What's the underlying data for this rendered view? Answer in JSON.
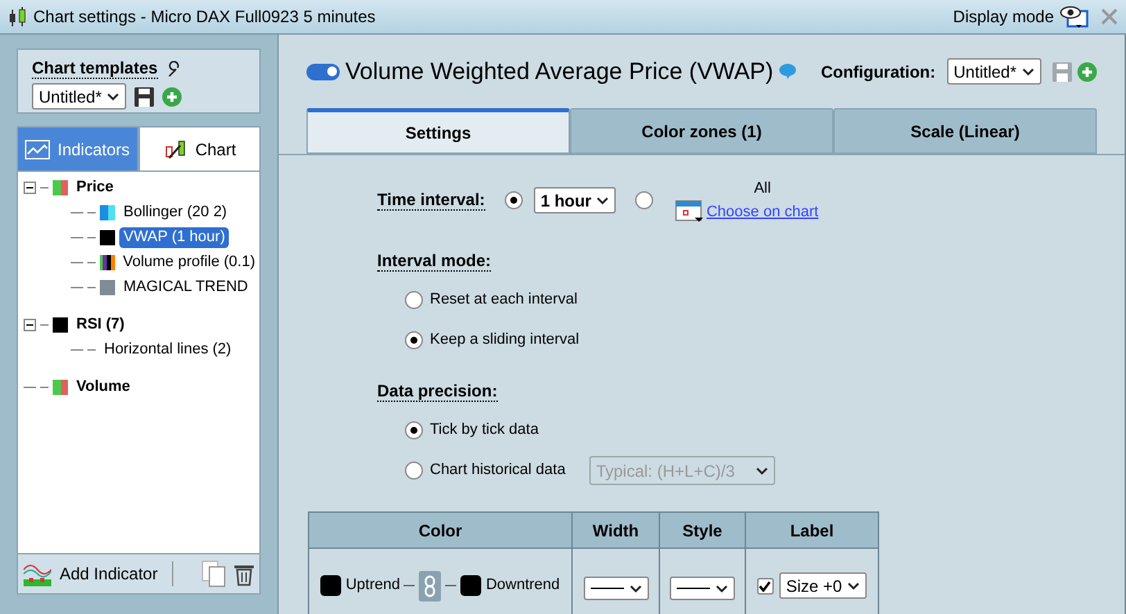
{
  "window": {
    "title": "Chart settings - Micro DAX Full0923 5 minutes",
    "display_mode": "Display mode"
  },
  "templates": {
    "label": "Chart templates",
    "value": "Untitled*"
  },
  "left_tabs": [
    {
      "label": "Indicators",
      "selected": true,
      "kind": "indicators"
    },
    {
      "label": "Chart",
      "selected": false,
      "kind": "chart"
    }
  ],
  "tree": [
    {
      "label": "Price",
      "bold": true,
      "expanded": true,
      "selected": false,
      "kind": "updown",
      "children": [
        {
          "label": "Bollinger (20 2)",
          "selected": false,
          "kind": "bands"
        },
        {
          "label": "VWAP (1 hour)",
          "selected": true,
          "kind": "solid",
          "color": "#000000"
        },
        {
          "label": "Volume profile (0.1)",
          "selected": false,
          "kind": "profile"
        },
        {
          "label": "MAGICAL TREND",
          "selected": false,
          "kind": "solid",
          "color": "#7f8c95"
        }
      ]
    },
    {
      "label": "RSI (7)",
      "bold": true,
      "expanded": true,
      "selected": false,
      "kind": "solid",
      "color": "#000000",
      "children": [
        {
          "label": "Horizontal lines (2)",
          "selected": false,
          "kind": "plain"
        }
      ]
    },
    {
      "label": "Volume",
      "bold": true,
      "selected": false,
      "kind": "updown"
    }
  ],
  "add_indicator": "Add Indicator",
  "indicator": {
    "enabled": true,
    "title": "Volume Weighted Average Price (VWAP)",
    "configuration_label": "Configuration:",
    "configuration_value": "Untitled*"
  },
  "tabs": [
    {
      "label": "Settings",
      "selected": true
    },
    {
      "label": "Color zones (1)",
      "selected": false
    },
    {
      "label": "Scale (Linear)",
      "selected": false
    }
  ],
  "time_interval": {
    "label": "Time interval:",
    "options": [
      {
        "kind": "select",
        "selected": true,
        "value": "1 hour"
      },
      {
        "kind": "chart",
        "selected": false,
        "caption": "All",
        "link": "Choose on chart"
      }
    ]
  },
  "interval_mode": {
    "label": "Interval mode:",
    "options": [
      {
        "label": "Reset at each interval",
        "selected": false
      },
      {
        "label": "Keep a sliding interval",
        "selected": true
      }
    ]
  },
  "data_precision": {
    "label": "Data precision:",
    "options": [
      {
        "label": "Tick by tick data",
        "selected": true
      },
      {
        "label": "Chart historical data",
        "selected": false,
        "select": "Typical: (H+L+C)/3"
      }
    ]
  },
  "table": {
    "columns": [
      "Color",
      "Width",
      "Style",
      "Label"
    ],
    "row": {
      "uptrend": {
        "label": "Uptrend",
        "color": "#000000"
      },
      "linked": true,
      "downtrend": {
        "label": "Downtrend",
        "color": "#000000"
      },
      "label_checked": true,
      "label_size": "Size +0"
    }
  }
}
